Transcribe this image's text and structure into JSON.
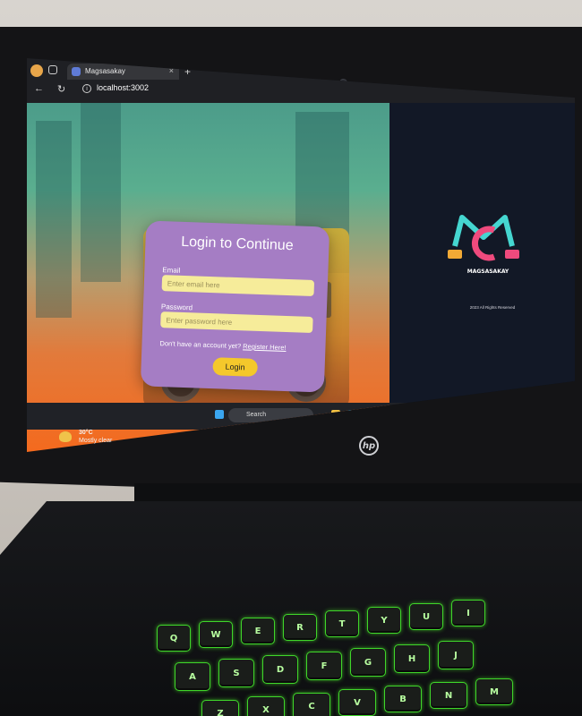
{
  "browser": {
    "tab_title": "Magsasakay",
    "tab_close": "×",
    "new_tab": "+",
    "address": "localhost:3002",
    "info_icon": "i"
  },
  "login": {
    "title": "Login to Continue",
    "email_label": "Email",
    "email_placeholder": "Enter email here",
    "password_label": "Password",
    "password_placeholder": "Enter password here",
    "register_prompt": "Don't have an account yet?",
    "register_link": "Register Here!",
    "button": "Login"
  },
  "brand": {
    "logo_text": "MAGSASAKAY",
    "rights": "2023 All Rights Reserved"
  },
  "taskbar": {
    "search": "Search"
  },
  "weather": {
    "temp": "30°C",
    "condition": "Mostly clear"
  },
  "laptop": {
    "logo": "hp"
  },
  "keyboard": {
    "keys": [
      "Q",
      "W",
      "E",
      "R",
      "T",
      "Y",
      "U",
      "I",
      "A",
      "S",
      "D",
      "F",
      "G",
      "H",
      "J",
      "Z",
      "X",
      "C",
      "V",
      "B",
      "N",
      "M"
    ]
  },
  "colors": {
    "card": "#a57dc4",
    "input": "#f6ec9a",
    "button": "#f4c82b",
    "key_glow": "#3fd62a"
  }
}
